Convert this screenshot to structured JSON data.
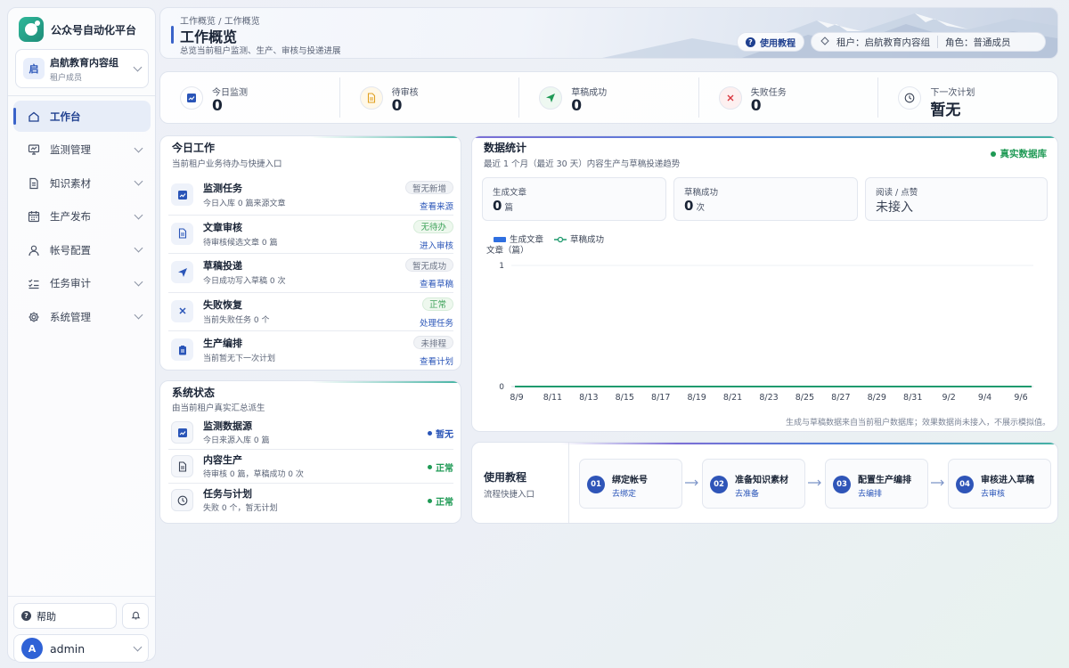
{
  "app": {
    "name": "公众号自动化平台",
    "tenant_avatar": "启",
    "tenant_name": "启航教育内容组",
    "tenant_role": "租户成员"
  },
  "nav": [
    {
      "label": "工作台",
      "icon": "home-icon",
      "active": true
    },
    {
      "label": "监测管理",
      "icon": "monitor-icon"
    },
    {
      "label": "知识素材",
      "icon": "document-icon"
    },
    {
      "label": "生产发布",
      "icon": "calendar-icon"
    },
    {
      "label": "帐号配置",
      "icon": "user-icon"
    },
    {
      "label": "任务审计",
      "icon": "checklist-icon"
    },
    {
      "label": "系统管理",
      "icon": "gear-icon"
    }
  ],
  "sidebar_footer": {
    "help_label": "帮助",
    "user_avatar": "A",
    "user_name": "admin"
  },
  "header": {
    "breadcrumb": "工作概览 / 工作概览",
    "title": "工作概览",
    "subtitle": "总览当前租户监测、生产、审核与投递进展",
    "tutorial_label": "使用教程",
    "tenant_label": "租户：启航教育内容组",
    "role_label": "角色：普通成员"
  },
  "stats": [
    {
      "label": "今日监测",
      "value": "0",
      "icon": "trend-icon",
      "color": "#2a55b8"
    },
    {
      "label": "待审核",
      "value": "0",
      "icon": "document-icon",
      "color": "#e0a020"
    },
    {
      "label": "草稿成功",
      "value": "0",
      "icon": "send-icon",
      "color": "#1f9a55"
    },
    {
      "label": "失败任务",
      "value": "0",
      "icon": "close-icon",
      "color": "#d9363e"
    },
    {
      "label": "下一次计划",
      "value": "暂无",
      "icon": "clock-icon",
      "color": "#3b4456"
    }
  ],
  "today_work": {
    "title": "今日工作",
    "subtitle": "当前租户业务待办与快捷入口",
    "rows": [
      {
        "title": "监测任务",
        "sub": "今日入库 0 篇来源文章",
        "badge": "暂无新增",
        "badge_green": false,
        "link": "查看来源",
        "icon": "trend-icon"
      },
      {
        "title": "文章审核",
        "sub": "待审核候选文章 0 篇",
        "badge": "无待办",
        "badge_green": true,
        "link": "进入审核",
        "icon": "document-icon"
      },
      {
        "title": "草稿投递",
        "sub": "今日成功写入草稿 0 次",
        "badge": "暂无成功",
        "badge_green": false,
        "link": "查看草稿",
        "icon": "send-icon"
      },
      {
        "title": "失败恢复",
        "sub": "当前失败任务 0 个",
        "badge": "正常",
        "badge_green": true,
        "link": "处理任务",
        "icon": "close-icon"
      },
      {
        "title": "生产编排",
        "sub": "当前暂无下一次计划",
        "badge": "未排程",
        "badge_green": false,
        "link": "查看计划",
        "icon": "clipboard-icon"
      }
    ]
  },
  "system_status": {
    "title": "系统状态",
    "subtitle": "由当前租户真实汇总派生",
    "rows": [
      {
        "title": "监测数据源",
        "sub": "今日来源入库 0 篇",
        "status": "暂无",
        "color": "#2a55b8",
        "icon": "trend-icon"
      },
      {
        "title": "内容生产",
        "sub": "待审核 0 篇，草稿成功 0 次",
        "status": "正常",
        "color": "#1f9a55",
        "icon": "document-icon"
      },
      {
        "title": "任务与计划",
        "sub": "失败 0 个，暂无计划",
        "status": "正常",
        "color": "#1f9a55",
        "icon": "clock-icon"
      }
    ]
  },
  "data_stats": {
    "title": "数据统计",
    "subtitle": "最近 1 个月（最近 30 天）内容生产与草稿投递趋势",
    "live_label": "真实数据库",
    "metrics": [
      {
        "label": "生成文章",
        "value": "0",
        "unit": "篇"
      },
      {
        "label": "草稿成功",
        "value": "0",
        "unit": "次"
      },
      {
        "label": "阅读 / 点赞",
        "value": "未接入",
        "unit": ""
      }
    ],
    "note": "生成与草稿数据来自当前租户数据库；效果数据尚未接入，不展示模拟值。"
  },
  "chart_data": {
    "type": "bar",
    "ylabel": "文章（篇）",
    "ylim": [
      0,
      1
    ],
    "yticks": [
      "0",
      "1"
    ],
    "x_tick_labels": [
      "8/9",
      "8/11",
      "8/13",
      "8/15",
      "8/17",
      "8/19",
      "8/21",
      "8/23",
      "8/25",
      "8/27",
      "8/29",
      "8/31",
      "9/2",
      "9/4",
      "9/6"
    ],
    "series": [
      {
        "name": "生成文章",
        "type": "bar",
        "color": "#2f6fe0",
        "values": [
          0,
          0,
          0,
          0,
          0,
          0,
          0,
          0,
          0,
          0,
          0,
          0,
          0,
          0,
          0
        ]
      },
      {
        "name": "草稿成功",
        "type": "line",
        "color": "#1f9a6e",
        "values": [
          0,
          0,
          0,
          0,
          0,
          0,
          0,
          0,
          0,
          0,
          0,
          0,
          0,
          0,
          0
        ]
      }
    ],
    "grid": true,
    "legend": "top-left"
  },
  "guide": {
    "title": "使用教程",
    "subtitle": "流程快捷入口",
    "steps": [
      {
        "num": "01",
        "title": "绑定帐号",
        "link": "去绑定"
      },
      {
        "num": "02",
        "title": "准备知识素材",
        "link": "去准备"
      },
      {
        "num": "03",
        "title": "配置生产编排",
        "link": "去编排"
      },
      {
        "num": "04",
        "title": "审核进入草稿",
        "link": "去审核"
      }
    ]
  }
}
